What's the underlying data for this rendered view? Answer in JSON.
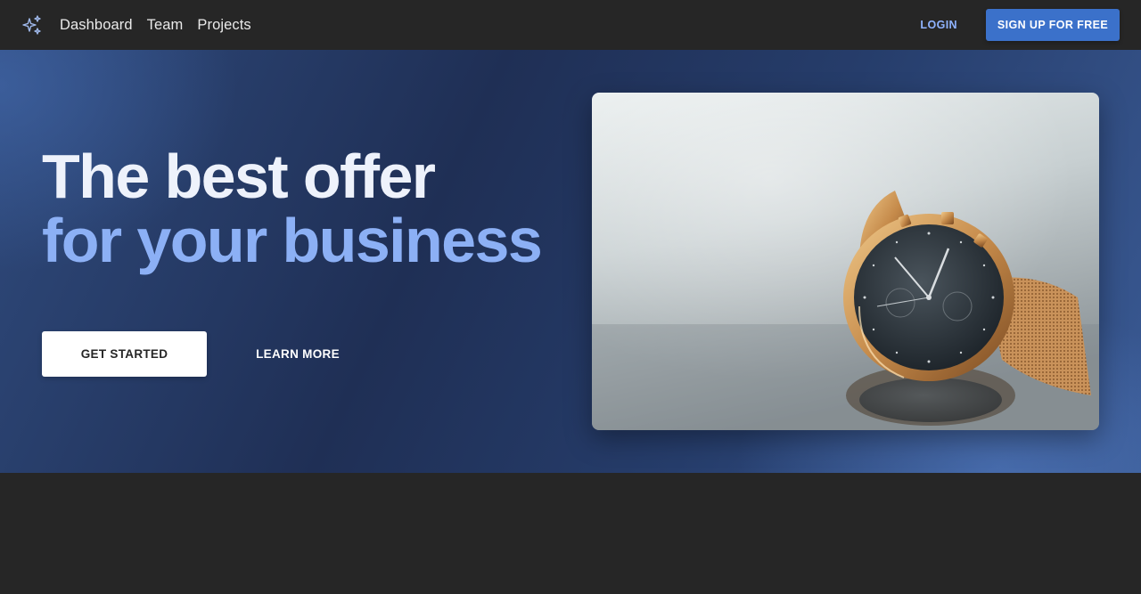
{
  "navbar": {
    "logo_icon": "sparkles-icon",
    "links": [
      "Dashboard",
      "Team",
      "Projects"
    ],
    "login_label": "LOGIN",
    "signup_label": "SIGN UP FOR FREE"
  },
  "hero": {
    "title_line1": "The best offer",
    "title_line2": "for your business",
    "primary_button": "GET STARTED",
    "secondary_button": "LEARN MORE",
    "image_alt": "gold wristwatch with dark dial"
  },
  "colors": {
    "accent": "#3b71ca",
    "title_highlight": "#8cb0f5",
    "navbar_bg": "#262626"
  }
}
